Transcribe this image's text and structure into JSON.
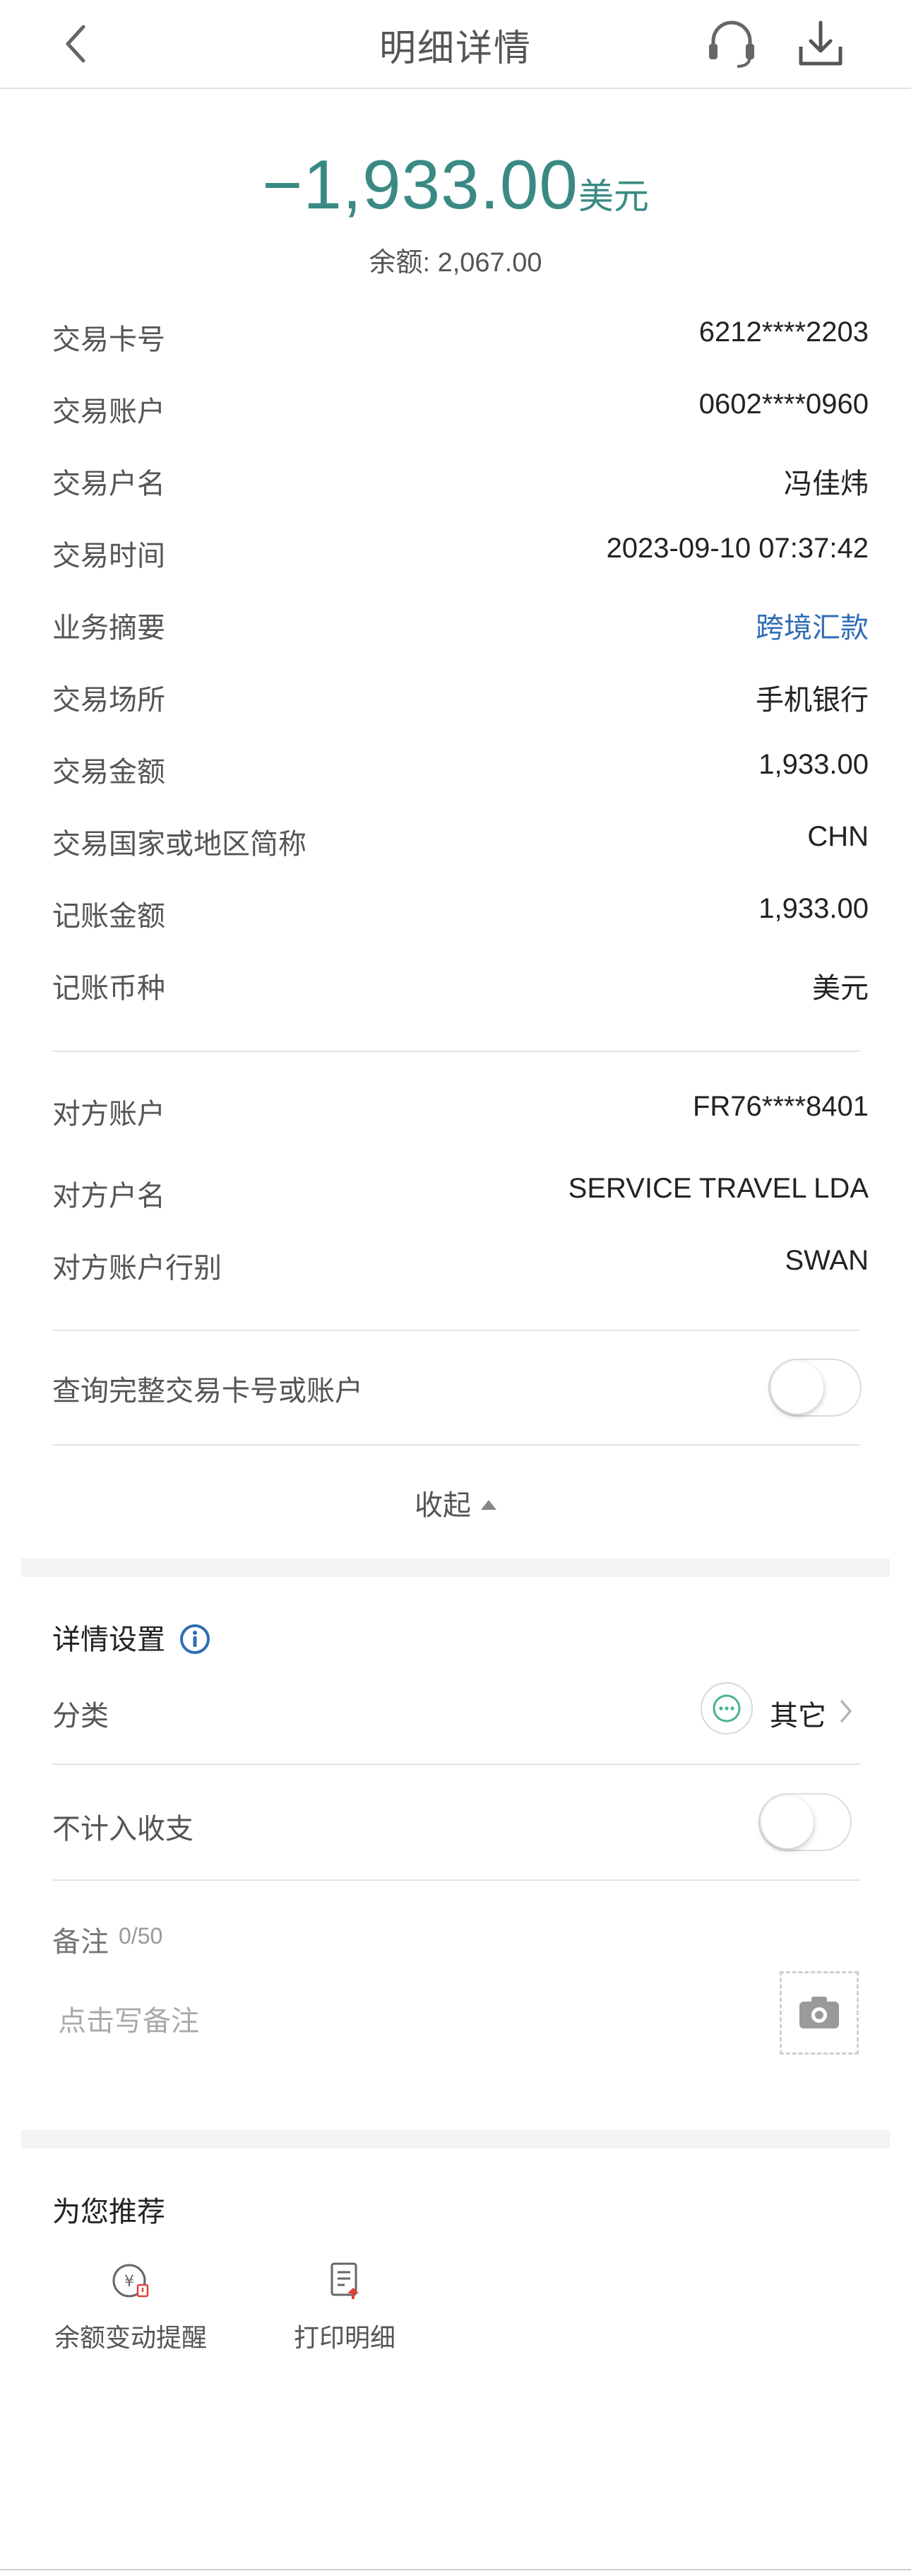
{
  "header": {
    "title": "明细详情"
  },
  "amount": {
    "value": "−1,933.00",
    "currency": "美元",
    "balance": "余额: 2,067.00"
  },
  "details": [
    {
      "label": "交易卡号",
      "value": "6212****2203"
    },
    {
      "label": "交易账户",
      "value": "0602****0960"
    },
    {
      "label": "交易户名",
      "value": "冯佳炜"
    },
    {
      "label": "交易时间",
      "value": "2023-09-10 07:37:42"
    },
    {
      "label": "业务摘要",
      "value": "跨境汇款"
    },
    {
      "label": "交易场所",
      "value": "手机银行"
    },
    {
      "label": "交易金额",
      "value": "1,933.00"
    },
    {
      "label": "交易国家或地区简称",
      "value": "CHN"
    },
    {
      "label": "记账金额",
      "value": "1,933.00"
    },
    {
      "label": "记账币种",
      "value": "美元"
    }
  ],
  "counterparty": [
    {
      "label": "对方账户",
      "value": "FR76****8401"
    },
    {
      "label": "对方户名",
      "value": "SERVICE TRAVEL LDA"
    },
    {
      "label": "对方账户行别",
      "value": "SWAN"
    }
  ],
  "full_account_toggle": {
    "label": "查询完整交易卡号或账户",
    "on": false
  },
  "collapse_label": "收起",
  "settings": {
    "title": "详情设置",
    "category_label": "分类",
    "category_value": "其它",
    "exclude_label": "不计入收支",
    "exclude_on": false,
    "note_label": "备注",
    "note_count": "0/50",
    "note_placeholder": "点击写备注"
  },
  "recommend": {
    "title": "为您推荐",
    "items": [
      {
        "label": "余额变动提醒",
        "icon": "balance-alert-icon"
      },
      {
        "label": "打印明细",
        "icon": "print-detail-icon"
      }
    ]
  },
  "colors": {
    "amount": "#3a8a83",
    "link": "#2f6db5",
    "info": "#2f6db5"
  }
}
